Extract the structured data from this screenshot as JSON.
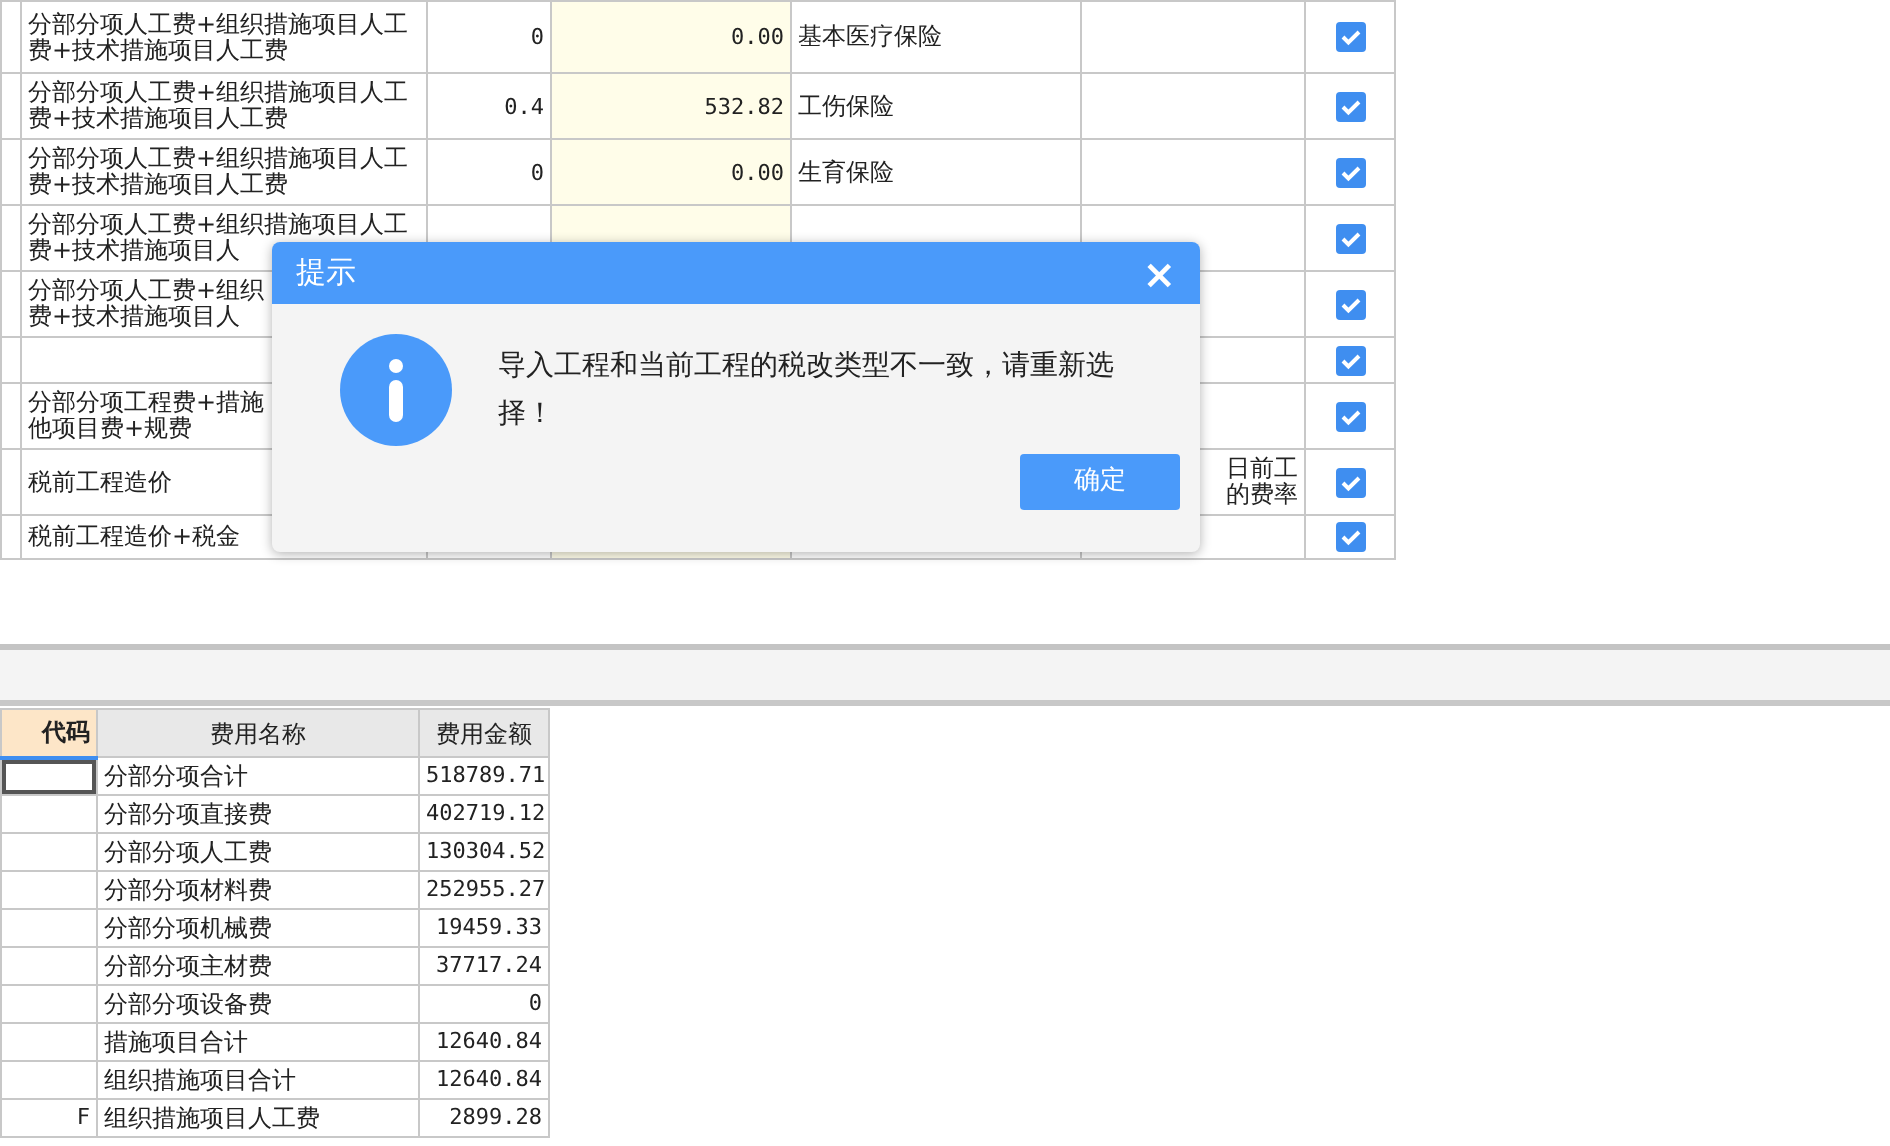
{
  "rate_table": {
    "rows": [
      {
        "formula": [
          "分部分项人工费+组织措施项目人工",
          "费+技术措施项目人工费"
        ],
        "rate": "0",
        "amount": "0.00",
        "name": "基本医疗保险",
        "remark": [],
        "checked": true
      },
      {
        "formula": [
          "分部分项人工费+组织措施项目人工",
          "费+技术措施项目人工费"
        ],
        "rate": "0.4",
        "amount": "532.82",
        "name": "工伤保险",
        "remark": [],
        "checked": true
      },
      {
        "formula": [
          "分部分项人工费+组织措施项目人工",
          "费+技术措施项目人工费"
        ],
        "rate": "0",
        "amount": "0.00",
        "name": "生育保险",
        "remark": [],
        "checked": true
      },
      {
        "formula": [
          "分部分项人工费+组织措施项目人工",
          "费+技术措施项目人"
        ],
        "rate": "",
        "amount": "",
        "name": "",
        "remark": [],
        "checked": true
      },
      {
        "formula": [
          "分部分项人工费+组织",
          "费+技术措施项目人"
        ],
        "rate": "",
        "amount": "",
        "name": "",
        "remark": [],
        "checked": true
      },
      {
        "formula": [],
        "rate": "",
        "amount": "",
        "name": "",
        "remark": [],
        "checked": true
      },
      {
        "formula": [
          "分部分项工程费+措施",
          "他项目费+规费"
        ],
        "rate": "",
        "amount": "",
        "name": "",
        "remark": [],
        "checked": true
      },
      {
        "formula": [
          "税前工程造价"
        ],
        "rate": "",
        "amount": "",
        "name": "",
        "remark": [
          "日前工",
          "的费率"
        ],
        "checked": true
      },
      {
        "formula": [
          "税前工程造价+税金"
        ],
        "rate": "",
        "amount": "",
        "name": "",
        "remark": [],
        "checked": true
      }
    ]
  },
  "cost_table": {
    "columns": [
      "代码",
      "费用名称",
      "费用金额"
    ],
    "rows": [
      {
        "code": "",
        "name": "分部分项合计",
        "amount": "518789.71",
        "selected": true
      },
      {
        "code": "",
        "name": "分部分项直接费",
        "amount": "402719.12",
        "selected": false
      },
      {
        "code": "",
        "name": "分部分项人工费",
        "amount": "130304.52",
        "selected": false
      },
      {
        "code": "",
        "name": "分部分项材料费",
        "amount": "252955.27",
        "selected": false
      },
      {
        "code": "",
        "name": "分部分项机械费",
        "amount": "19459.33",
        "selected": false
      },
      {
        "code": "",
        "name": "分部分项主材费",
        "amount": "37717.24",
        "selected": false
      },
      {
        "code": "",
        "name": "分部分项设备费",
        "amount": "0",
        "selected": false
      },
      {
        "code": "",
        "name": "措施项目合计",
        "amount": "12640.84",
        "selected": false
      },
      {
        "code": "",
        "name": "组织措施项目合计",
        "amount": "12640.84",
        "selected": false
      },
      {
        "code": "F",
        "name": "组织措施项目人工费",
        "amount": "2899.28",
        "selected": false
      }
    ]
  },
  "dialog": {
    "title": "提示",
    "close": "×",
    "message": "导入工程和当前工程的税改类型不一致，请重新选择！",
    "button": "确定"
  }
}
